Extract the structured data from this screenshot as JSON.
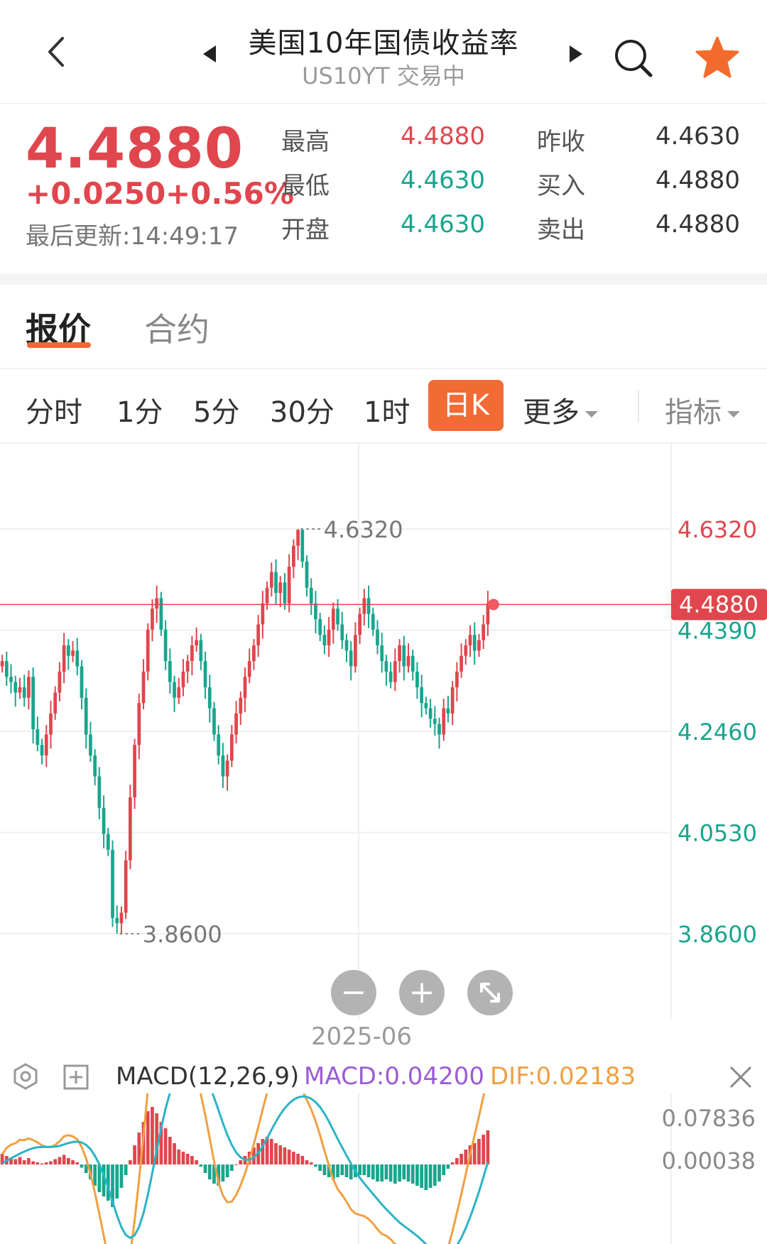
{
  "header": {
    "back_icon": "chevron-left-icon",
    "prev_icon": "triangle-left-icon",
    "next_icon": "triangle-right-icon",
    "search_icon": "search-icon",
    "favorite_icon": "star-icon",
    "title": "美国10年国债收益率",
    "subtitle": "US10YT 交易中",
    "accent": "#f06a33"
  },
  "quote": {
    "price": "4.4880",
    "change_abs": "+0.0250",
    "change_pct": "+0.56%",
    "updated": "最后更新:14:49:17",
    "stats": [
      {
        "label": "最高",
        "value": "4.4880",
        "color": "red"
      },
      {
        "label": "最低",
        "value": "4.4630",
        "color": "green"
      },
      {
        "label": "开盘",
        "value": "4.4630",
        "color": "green"
      },
      {
        "label": "昨收",
        "value": "4.4630",
        "color": "dark"
      },
      {
        "label": "买入",
        "value": "4.4880",
        "color": "dark"
      },
      {
        "label": "卖出",
        "value": "4.4880",
        "color": "dark"
      }
    ]
  },
  "tabs": {
    "quote": "报价",
    "contract": "合约"
  },
  "periods": {
    "items": [
      "分时",
      "1分",
      "5分",
      "30分",
      "1时"
    ],
    "active": "日K",
    "more": "更多",
    "indicators": "指标",
    "dropdown_icon": "caret-down-icon"
  },
  "chart": {
    "axis_labels": [
      "4.6320",
      "4.4390",
      "4.2460",
      "4.0530",
      "3.8600"
    ],
    "current_price_tag": "4.4880",
    "high_annotation": "4.6320",
    "low_annotation": "3.8600",
    "date_label": "2025-06",
    "zoom_out": "−",
    "zoom_in": "+",
    "expand_icon": "expand-icon",
    "up_color": "#e0464d",
    "down_color": "#19a58d"
  },
  "macd": {
    "settings_icon": "settings-icon",
    "add_icon": "plus-square-icon",
    "close_icon": "close-icon",
    "title": "MACD(12,26,9)",
    "macd_value": "MACD:0.04200",
    "dif_value": "DIF:0.02183",
    "axis_labels": [
      "0.07836",
      "0.00038"
    ]
  },
  "chart_data": {
    "type": "candlestick",
    "title": "美国10年国债收益率",
    "ylim": [
      3.86,
      4.632
    ],
    "y_ticks": [
      4.632,
      4.439,
      4.246,
      4.053,
      3.86
    ],
    "current": 4.488,
    "high_label": 4.632,
    "low_label": 3.86,
    "x_label": "2025-06",
    "closes": [
      4.38,
      4.35,
      4.34,
      4.32,
      4.33,
      4.31,
      4.35,
      4.25,
      4.22,
      4.2,
      4.24,
      4.28,
      4.32,
      4.36,
      4.41,
      4.39,
      4.4,
      4.37,
      4.31,
      4.24,
      4.2,
      4.16,
      4.1,
      4.05,
      4.02,
      3.89,
      3.88,
      3.9,
      4.0,
      4.12,
      4.22,
      4.3,
      4.36,
      4.44,
      4.48,
      4.5,
      4.44,
      4.38,
      4.34,
      4.31,
      4.33,
      4.36,
      4.38,
      4.41,
      4.42,
      4.38,
      4.33,
      4.29,
      4.24,
      4.2,
      4.16,
      4.19,
      4.24,
      4.28,
      4.31,
      4.35,
      4.38,
      4.41,
      4.45,
      4.49,
      4.52,
      4.55,
      4.51,
      4.53,
      4.49,
      4.56,
      4.6,
      4.63,
      4.57,
      4.52,
      4.49,
      4.46,
      4.43,
      4.41,
      4.44,
      4.48,
      4.45,
      4.42,
      4.4,
      4.37,
      4.43,
      4.47,
      4.5,
      4.47,
      4.44,
      4.41,
      4.38,
      4.36,
      4.34,
      4.38,
      4.41,
      4.37,
      4.39,
      4.36,
      4.33,
      4.3,
      4.29,
      4.27,
      4.26,
      4.24,
      4.29,
      4.28,
      4.33,
      4.36,
      4.39,
      4.41,
      4.43,
      4.4,
      4.42,
      4.45,
      4.49
    ],
    "macd_hist": [
      0.01,
      0.008,
      0.006,
      0.005,
      0.007,
      0.004,
      0.006,
      0.003,
      0.002,
      0.001,
      0.002,
      0.003,
      0.005,
      0.007,
      0.009,
      0.006,
      0.004,
      0.002,
      -0.003,
      -0.008,
      -0.014,
      -0.02,
      -0.026,
      -0.03,
      -0.034,
      -0.04,
      -0.032,
      -0.022,
      -0.01,
      0.004,
      0.018,
      0.03,
      0.04,
      0.05,
      0.054,
      0.048,
      0.04,
      0.034,
      0.026,
      0.02,
      0.014,
      0.012,
      0.01,
      0.008,
      0.004,
      -0.002,
      -0.008,
      -0.014,
      -0.018,
      -0.02,
      -0.016,
      -0.012,
      -0.006,
      0.0,
      0.004,
      0.008,
      0.012,
      0.016,
      0.02,
      0.024,
      0.026,
      0.024,
      0.02,
      0.018,
      0.016,
      0.014,
      0.012,
      0.01,
      0.008,
      0.004,
      0.002,
      -0.002,
      -0.006,
      -0.01,
      -0.012,
      -0.014,
      -0.012,
      -0.01,
      -0.012,
      -0.014,
      -0.012,
      -0.01,
      -0.01,
      -0.012,
      -0.014,
      -0.016,
      -0.016,
      -0.014,
      -0.016,
      -0.018,
      -0.016,
      -0.014,
      -0.016,
      -0.018,
      -0.02,
      -0.022,
      -0.024,
      -0.022,
      -0.02,
      -0.016,
      -0.01,
      -0.004,
      0.002,
      0.006,
      0.01,
      0.014,
      0.018,
      0.02,
      0.024,
      0.028,
      0.032
    ]
  }
}
